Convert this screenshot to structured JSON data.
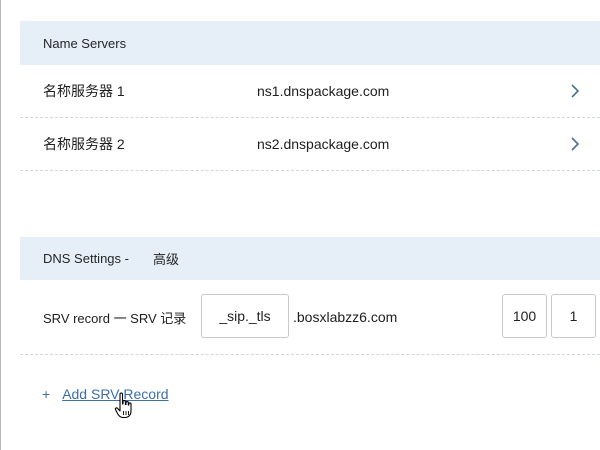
{
  "name_servers": {
    "title": "Name Servers",
    "rows": [
      {
        "label": "名称服务器 1",
        "value": "ns1.dnspackage.com"
      },
      {
        "label": "名称服务器 2",
        "value": "ns2.dnspackage.com"
      }
    ]
  },
  "dns_settings": {
    "title": "DNS Settings -",
    "title_suffix": "高级",
    "srv": {
      "label": "SRV record 一 SRV 记录",
      "service_value": "_sip._tls",
      "domain_suffix": ".bosxlabzz6.com",
      "priority_value": "100",
      "weight_value": "1"
    }
  },
  "add_srv": {
    "plus": "+",
    "label": "Add SRV Record"
  },
  "icons": {
    "chevron": "chevron-right-icon",
    "cursor": "hand-pointer-cursor"
  },
  "colors": {
    "header_bg": "#e6eef8",
    "link": "#3d6ea8",
    "chevron": "#4a6f9a"
  }
}
